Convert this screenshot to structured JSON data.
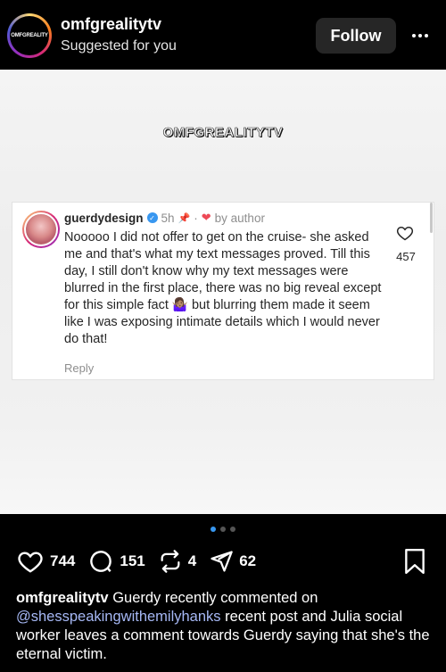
{
  "header": {
    "avatar_text": "OMFGREALITY",
    "username": "omfgrealitytv",
    "subtitle": "Suggested for you",
    "follow_label": "Follow"
  },
  "media": {
    "brand_text": "OMFGREALITYTV",
    "comment": {
      "username": "guerdydesign",
      "time": "5h",
      "by_author": "by author",
      "text": "Nooooo I did not offer to get on the cruise- she asked me and that's what my text messages proved. Till this day, I still don't know why my text messages were blurred in the first place, there was no big reveal except for this simple fact 🤷🏽‍♀️ but blurring them made it seem like I was exposing intimate details which I would never do that!",
      "reply_label": "Reply",
      "like_count": "457"
    }
  },
  "carousel": {
    "count": 3,
    "active_index": 0
  },
  "actions": {
    "likes": "744",
    "comments": "151",
    "reposts": "4",
    "shares": "62"
  },
  "caption": {
    "username": "omfgrealitytv",
    "text_1": " Guerdy recently commented on ",
    "mention": "@shesspeakingwithemilyhanks",
    "text_2": " recent post and Julia social worker leaves a comment towards Guerdy saying that she's the eternal victim."
  },
  "colors": {
    "accent": "#3897f0",
    "heart": "#ed4956",
    "mention": "#a6b8f5"
  }
}
